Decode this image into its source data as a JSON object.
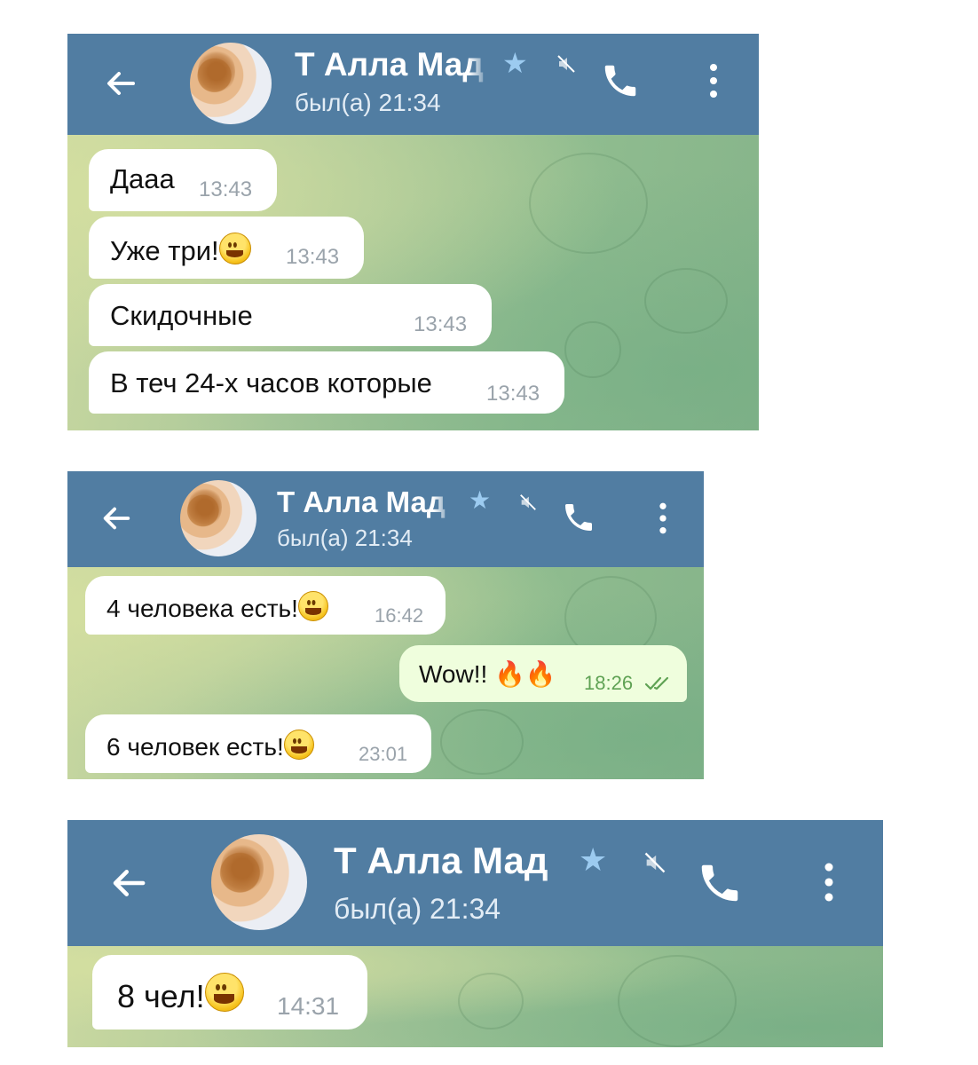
{
  "chat": {
    "name": "Т Алла Мад",
    "status": "был(а) 21:34",
    "star_icon": "★",
    "accent": "#517da2"
  },
  "shot1": {
    "messages": [
      {
        "text": "Дааа",
        "time": "13:43"
      },
      {
        "text": "Уже три!",
        "time": "13:43"
      },
      {
        "text": "Скидочные",
        "time": "13:43"
      },
      {
        "text": "В теч 24-х часов которые",
        "time": "13:43"
      }
    ]
  },
  "shot2": {
    "messages": [
      {
        "text": "4 человека есть!",
        "time": "16:42"
      },
      {
        "text": "Wow!!",
        "time": "18:26"
      },
      {
        "text": "6 человек есть!",
        "time": "23:01"
      }
    ]
  },
  "shot3": {
    "messages": [
      {
        "text": "8 чел!",
        "time": "14:31"
      }
    ]
  }
}
